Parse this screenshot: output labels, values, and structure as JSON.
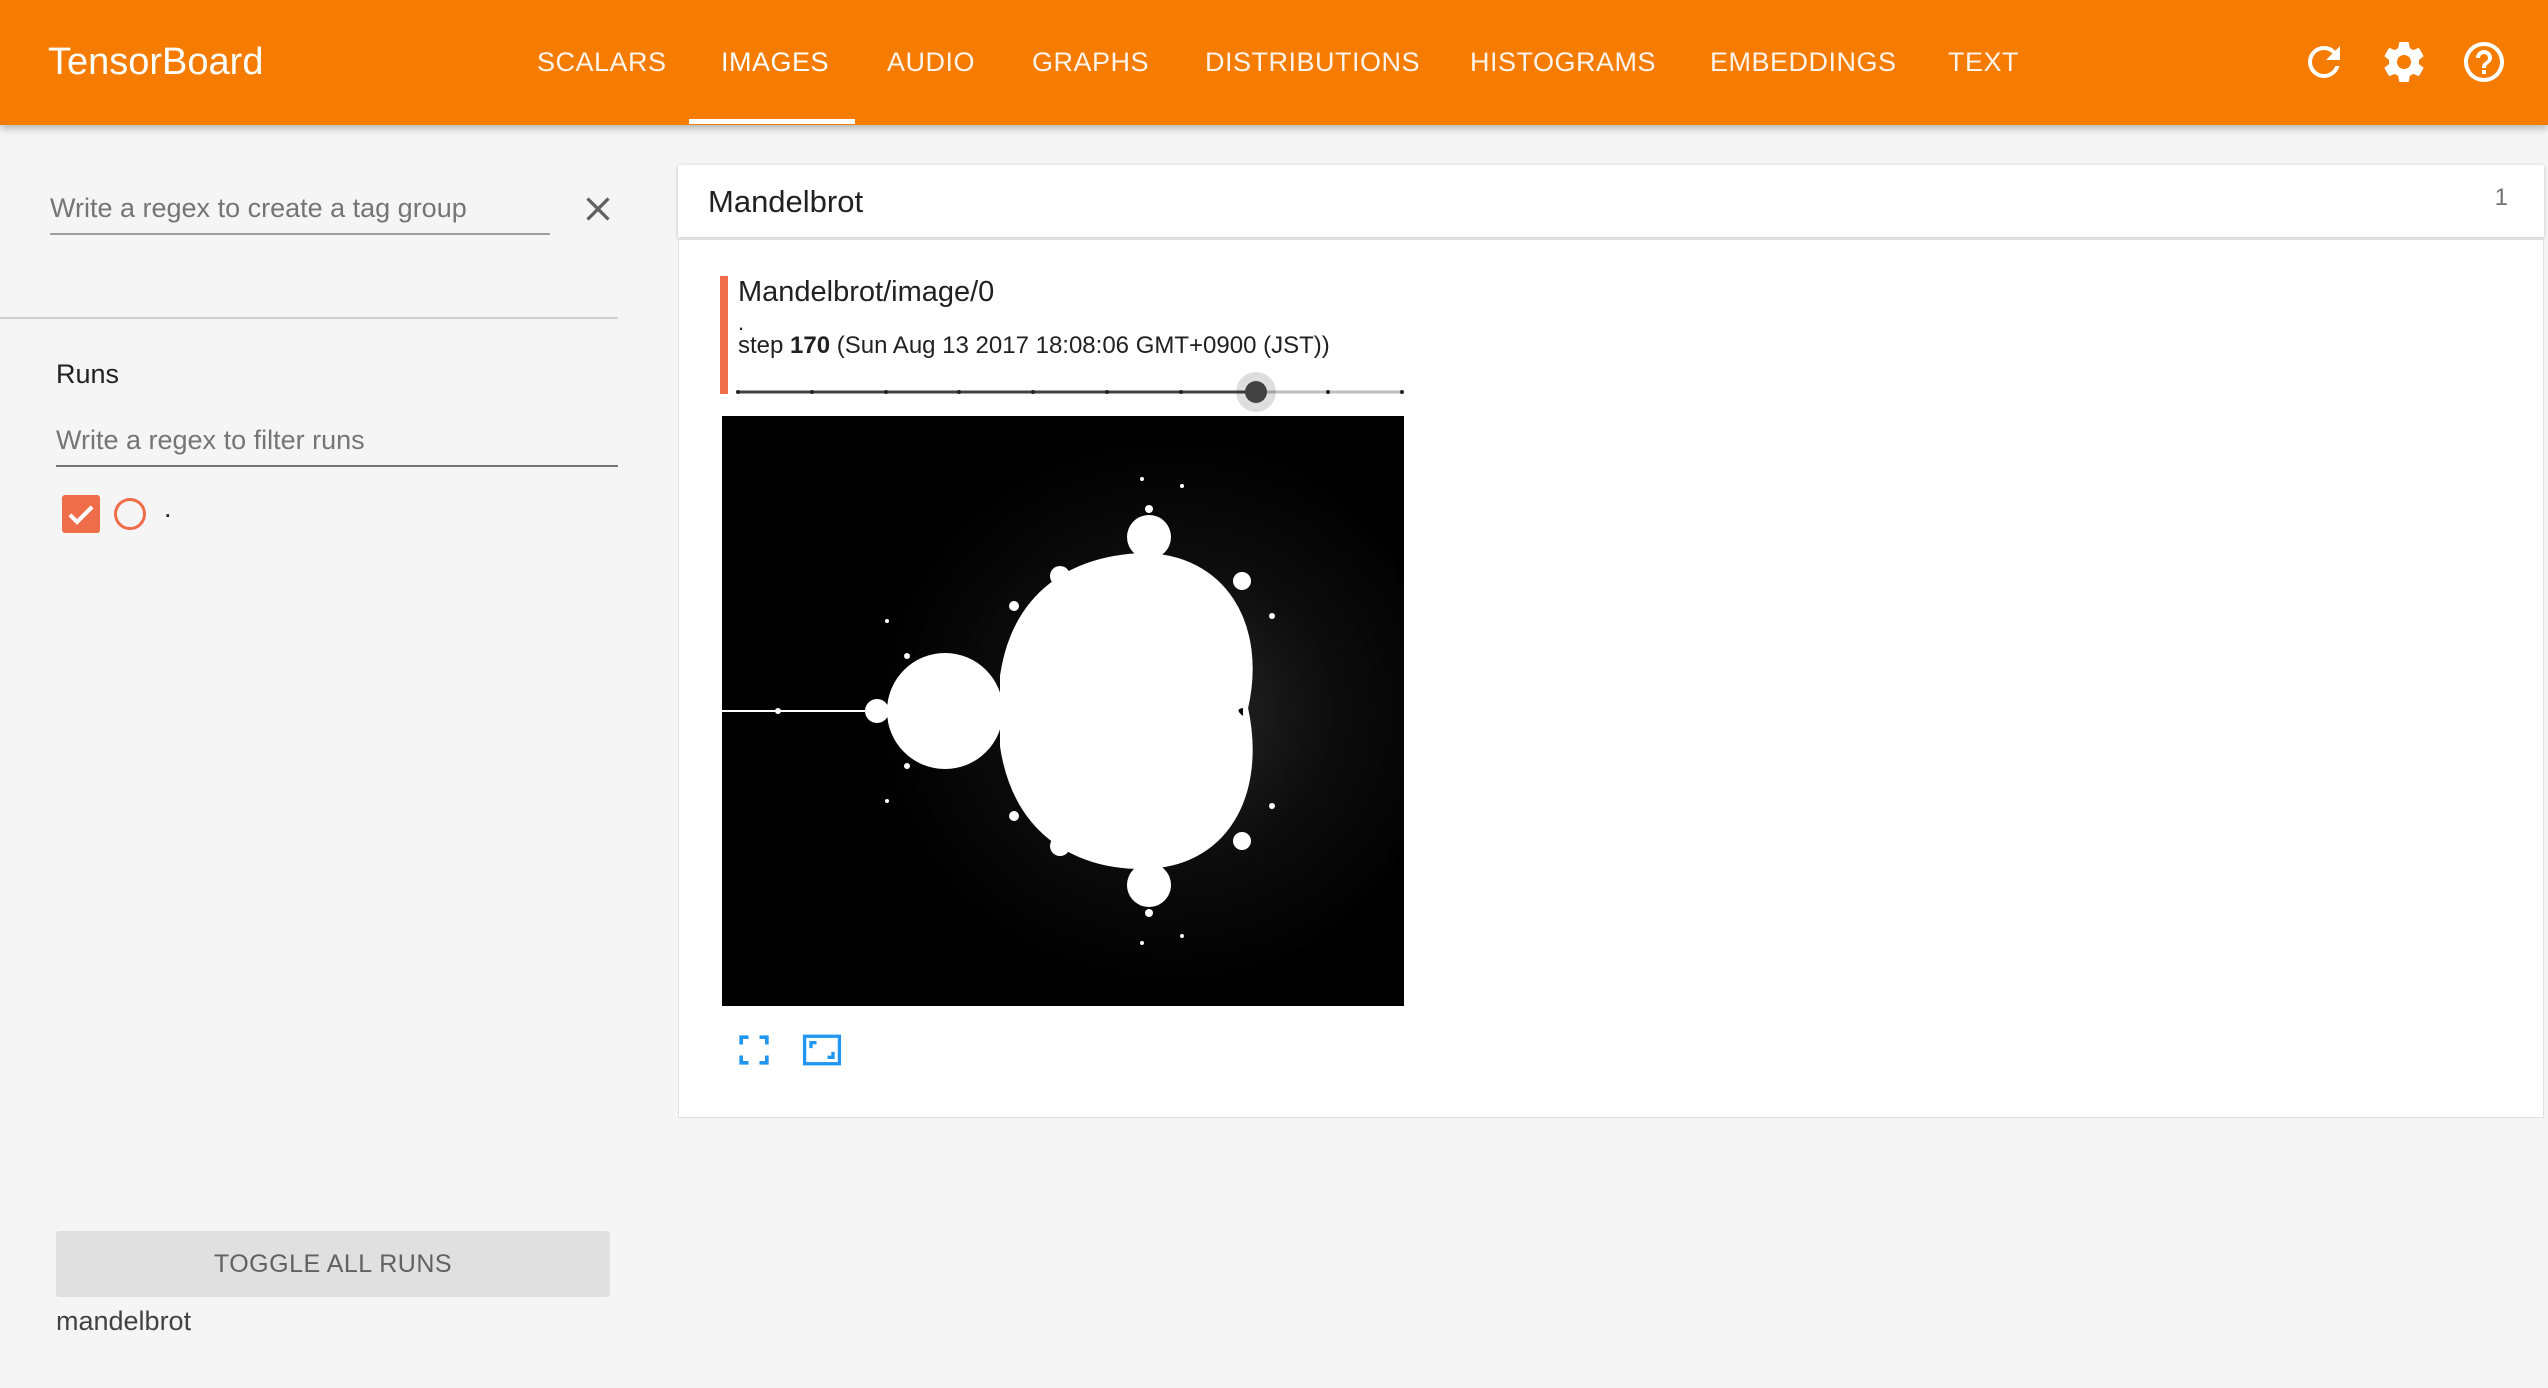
{
  "app": {
    "title": "TensorBoard"
  },
  "nav": {
    "tabs": [
      {
        "label": "SCALARS"
      },
      {
        "label": "IMAGES"
      },
      {
        "label": "AUDIO"
      },
      {
        "label": "GRAPHS"
      },
      {
        "label": "DISTRIBUTIONS"
      },
      {
        "label": "HISTOGRAMS"
      },
      {
        "label": "EMBEDDINGS"
      },
      {
        "label": "TEXT"
      }
    ],
    "active_tab": "IMAGES",
    "icons": [
      "refresh-icon",
      "settings-icon",
      "help-icon"
    ]
  },
  "sidebar": {
    "tag_group_placeholder": "Write a regex to create a tag group",
    "tag_group_value": "",
    "runs_title": "Runs",
    "runs_filter_placeholder": "Write a regex to filter runs",
    "runs_filter_value": "",
    "runs": [
      {
        "name": ".",
        "checked": true,
        "color": "#f06d4a"
      }
    ],
    "toggle_all_label": "TOGGLE ALL RUNS",
    "log_dir": "mandelbrot"
  },
  "main": {
    "category": {
      "title": "Mandelbrot",
      "count": "1"
    },
    "image": {
      "tag": "Mandelbrot/image/0",
      "run": ".",
      "step_prefix": "step",
      "step": "170",
      "time": "(Sun Aug 13 2017 18:08:06 GMT+0900 (JST))",
      "slider_fraction": 0.78,
      "actions": [
        "fullscreen-icon",
        "actual-size-icon"
      ]
    }
  },
  "colors": {
    "header": "#f57c00",
    "run_accent": "#f06d4a",
    "action_blue": "#2196f3",
    "background": "#f5f5f5"
  }
}
